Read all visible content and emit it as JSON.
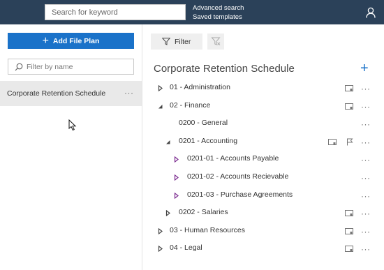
{
  "header": {
    "search_placeholder": "Search for keyword",
    "advanced_search": "Advanced search",
    "saved_templates": "Saved templates",
    "user_icon": "user-icon"
  },
  "sidebar": {
    "add_button_label": "Add File Plan",
    "filter_placeholder": "Filter by name",
    "plans": [
      {
        "name": "Corporate Retention Schedule"
      }
    ]
  },
  "toolbar": {
    "filter_label": "Filter",
    "clear_filter_icon": "clear-filter-icon"
  },
  "tree": {
    "title": "Corporate Retention Schedule",
    "rows": [
      {
        "label": "01 - Administration",
        "level": 0,
        "expander": "collapsed",
        "card": true,
        "flag": false
      },
      {
        "label": "02 - Finance",
        "level": 0,
        "expander": "expanded",
        "card": true,
        "flag": false
      },
      {
        "label": "0200 - General",
        "level": 1,
        "expander": "none",
        "card": false,
        "flag": false
      },
      {
        "label": "0201 - Accounting",
        "level": 1,
        "expander": "expanded",
        "card": true,
        "flag": true
      },
      {
        "label": "0201-01 - Accounts Payable",
        "level": 2,
        "expander": "collapsed-purple",
        "card": false,
        "flag": false
      },
      {
        "label": "0201-02 - Accounts Recievable",
        "level": 2,
        "expander": "collapsed-purple",
        "card": false,
        "flag": false
      },
      {
        "label": "0201-03 - Purchase Agreements",
        "level": 2,
        "expander": "collapsed-purple",
        "card": false,
        "flag": false
      },
      {
        "label": "0202 - Salaries",
        "level": 1,
        "expander": "collapsed",
        "card": true,
        "flag": false
      },
      {
        "label": "03 - Human Resources",
        "level": 0,
        "expander": "collapsed",
        "card": true,
        "flag": false
      },
      {
        "label": "04 - Legal",
        "level": 0,
        "expander": "collapsed",
        "card": true,
        "flag": false
      }
    ]
  },
  "more_glyph": "···",
  "colors": {
    "topbar": "#2b4159",
    "accent": "#1a72c9",
    "selected_row": "#e9e9e9",
    "purple_expander": "#7a2a8f"
  }
}
